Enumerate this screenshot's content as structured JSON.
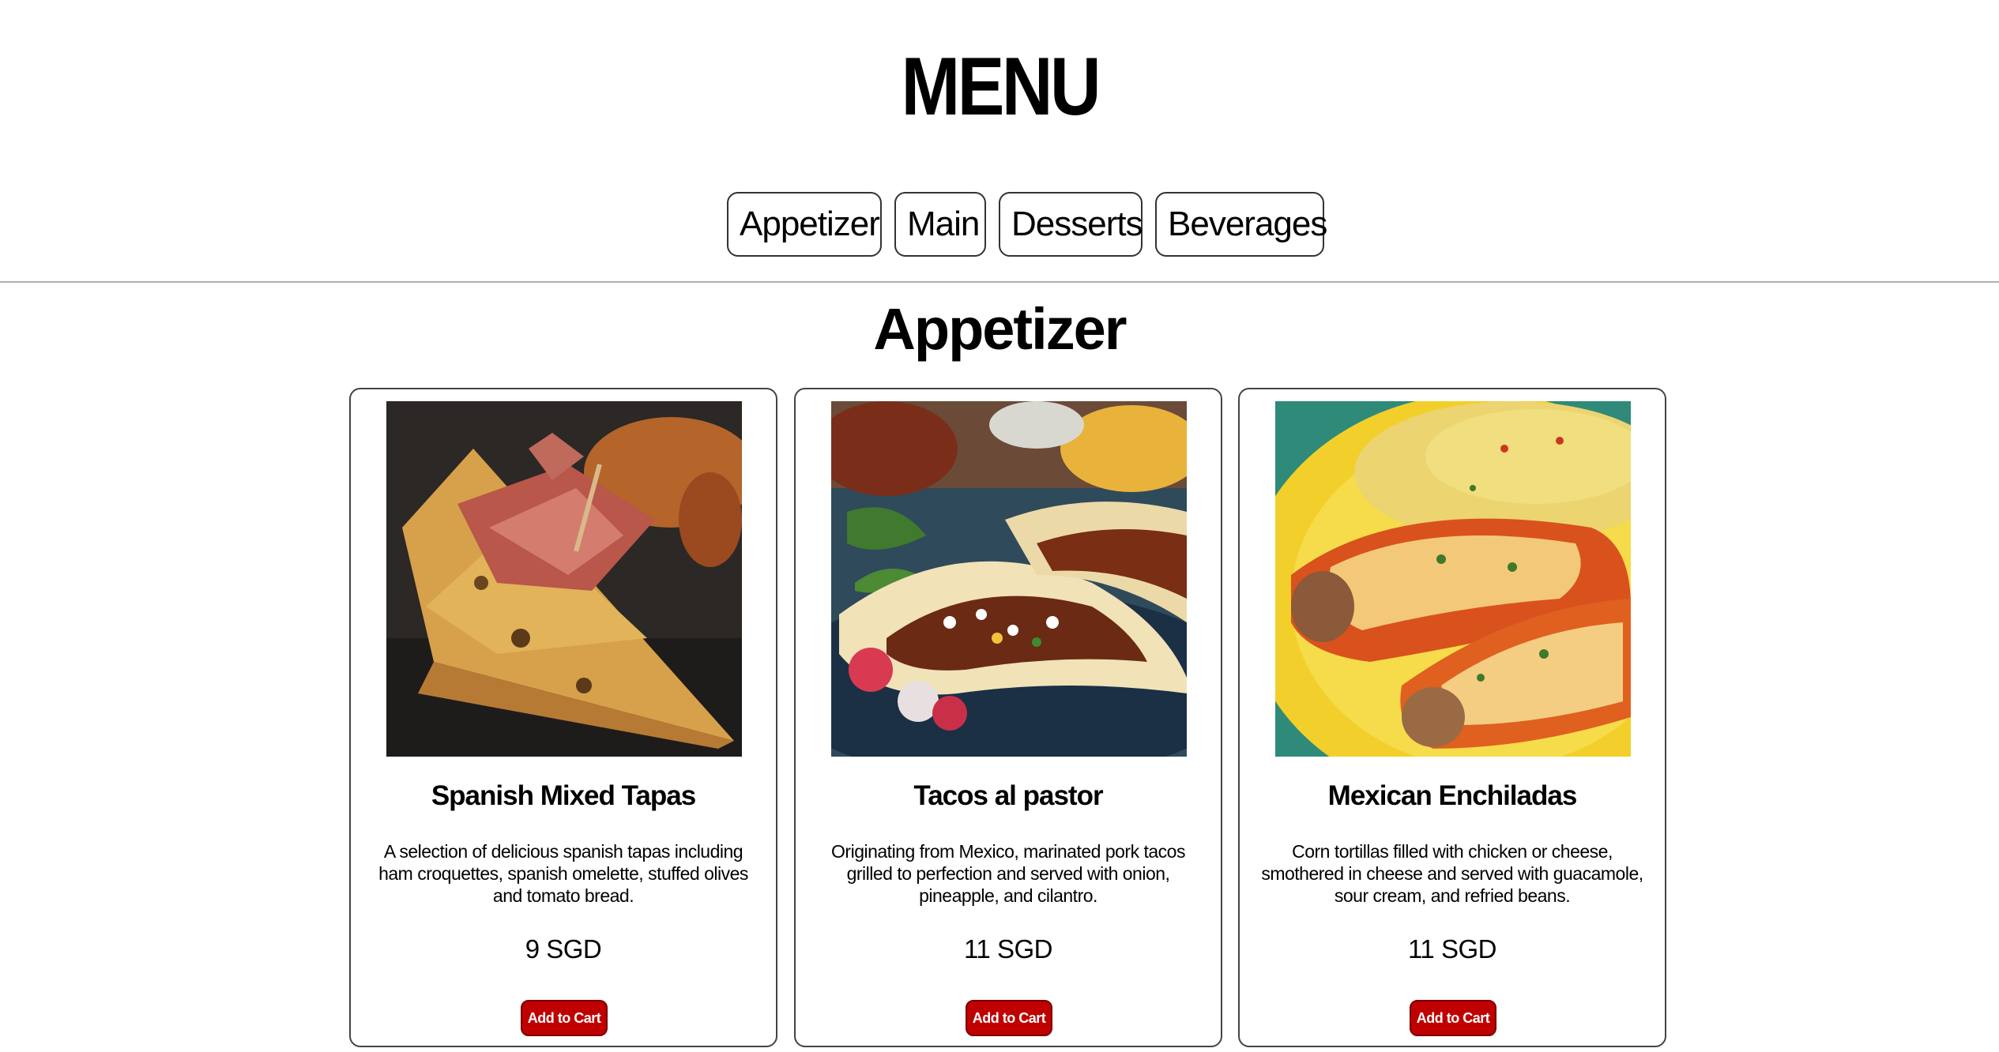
{
  "page": {
    "title": "MENU"
  },
  "tabs": [
    {
      "label": "Appetizer"
    },
    {
      "label": "Main"
    },
    {
      "label": "Desserts"
    },
    {
      "label": "Beverages"
    }
  ],
  "section": {
    "title": "Appetizer"
  },
  "items": [
    {
      "name": "Spanish Mixed Tapas",
      "description": "A selection of delicious spanish tapas including ham croquettes, spanish omelette, stuffed olives and tomato bread.",
      "price": "9 SGD",
      "button_label": "Add to Cart",
      "image_icon": "tapas-photo"
    },
    {
      "name": "Tacos al pastor",
      "description": "Originating from Mexico, marinated pork tacos grilled to perfection and served with onion, pineapple, and cilantro.",
      "price": "11 SGD",
      "button_label": "Add to Cart",
      "image_icon": "tacos-photo"
    },
    {
      "name": "Mexican Enchiladas",
      "description": "Corn tortillas filled with chicken or cheese, smothered in cheese and served with guacamole, sour cream, and refried beans.",
      "price": "11 SGD",
      "button_label": "Add to Cart",
      "image_icon": "enchiladas-photo"
    }
  ],
  "colors": {
    "accent": "#c00000",
    "border": "#444444",
    "divider": "#b0b0b0"
  }
}
